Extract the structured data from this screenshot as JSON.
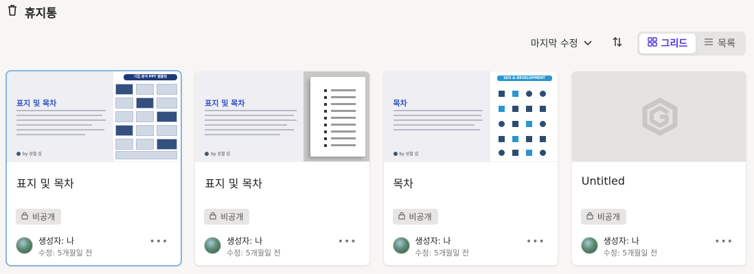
{
  "header": {
    "title": "휴지통",
    "icon": "trash-icon"
  },
  "toolbar": {
    "sort_label": "마지막 수정",
    "grid_label": "그리드",
    "list_label": "목록",
    "active_view": "grid"
  },
  "colors": {
    "accent": "#4a34d6",
    "selected_border": "#8ab4e0",
    "thumb_blue": "#2f52c6"
  },
  "cards": [
    {
      "title": "표지 및 목차",
      "badge": "비공개",
      "creator": "생성자: 나",
      "modified": "수정: 5개월일 전",
      "thumb": {
        "heading": "표지 및 목차",
        "author": "by 상철 김",
        "banner": "기업 분석 PPT 템플릿"
      }
    },
    {
      "title": "표지 및 목차",
      "badge": "비공개",
      "creator": "생성자: 나",
      "modified": "수정: 5개월일 전",
      "thumb": {
        "heading": "표지 및 목차",
        "author": "by 상철 김"
      }
    },
    {
      "title": "목차",
      "badge": "비공개",
      "creator": "생성자: 나",
      "modified": "수정: 5개월일 전",
      "thumb": {
        "heading": "목차",
        "author": "by 상철 김",
        "banner": "SEO & DEVELOPMENT"
      }
    },
    {
      "title": "Untitled",
      "badge": "비공개",
      "creator": "생성자: 나",
      "modified": "수정: 5개월일 전"
    }
  ]
}
